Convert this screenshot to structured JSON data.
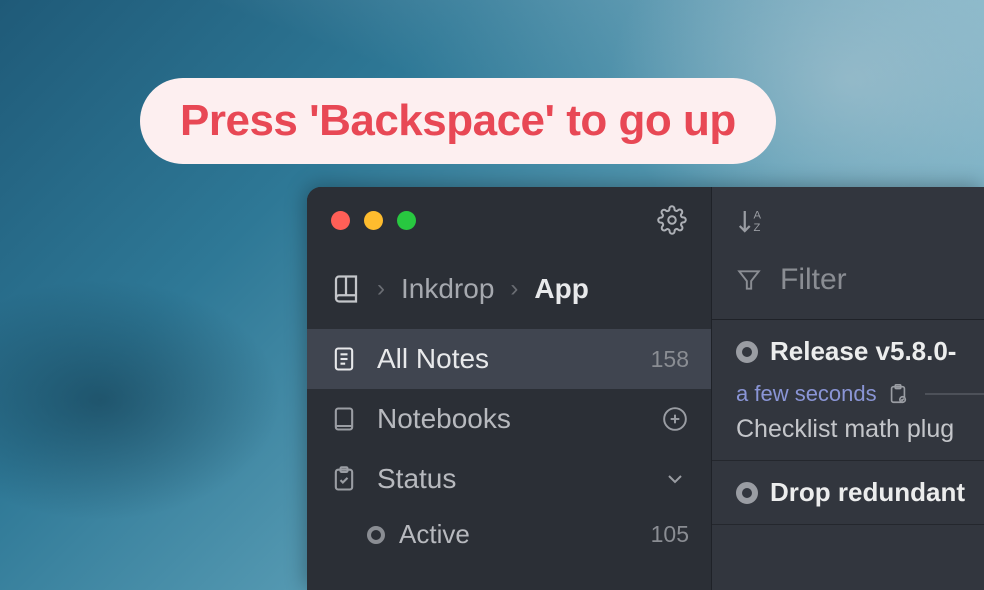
{
  "banner": {
    "text": "Press 'Backspace' to go up"
  },
  "breadcrumb": {
    "root_label": "Inkdrop",
    "current_label": "App"
  },
  "sidebar": {
    "all_notes": {
      "label": "All Notes",
      "count": "158"
    },
    "notebooks": {
      "label": "Notebooks"
    },
    "status": {
      "label": "Status"
    },
    "active": {
      "label": "Active",
      "count": "105"
    }
  },
  "filter": {
    "placeholder": "Filter"
  },
  "notes": [
    {
      "title": "Release v5.8.0-",
      "time": "a few seconds",
      "preview": "Checklist math plug"
    },
    {
      "title": "Drop redundant"
    }
  ]
}
